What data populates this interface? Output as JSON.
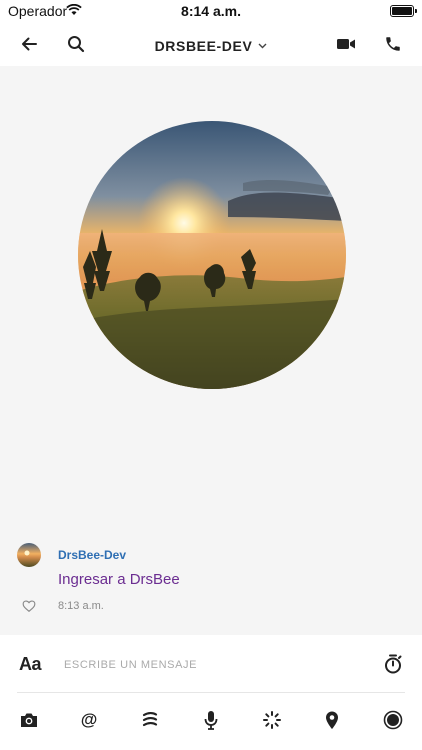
{
  "status_bar": {
    "carrier": "Operador",
    "time": "8:14 a.m."
  },
  "nav": {
    "title": "DRSBEE-DEV",
    "icons": [
      "back-arrow-icon",
      "search-icon",
      "chevron-down-icon",
      "video-call-icon",
      "phone-icon"
    ]
  },
  "message": {
    "sender": "DrsBee-Dev",
    "text": "Ingresar a DrsBee",
    "time": "8:13 a.m."
  },
  "composer": {
    "font_label": "Aa",
    "placeholder": "ESCRIBE UN MENSAJE",
    "at_label": "@"
  },
  "toolbar": {
    "icons": [
      "camera-icon",
      "at-icon",
      "giphy-icon",
      "microphone-icon",
      "sparkle-icon",
      "location-pin-icon",
      "record-icon"
    ]
  },
  "colors": {
    "sender": "#2f6fb3",
    "message_link": "#6b2d91",
    "background": "#f5f5f5"
  }
}
